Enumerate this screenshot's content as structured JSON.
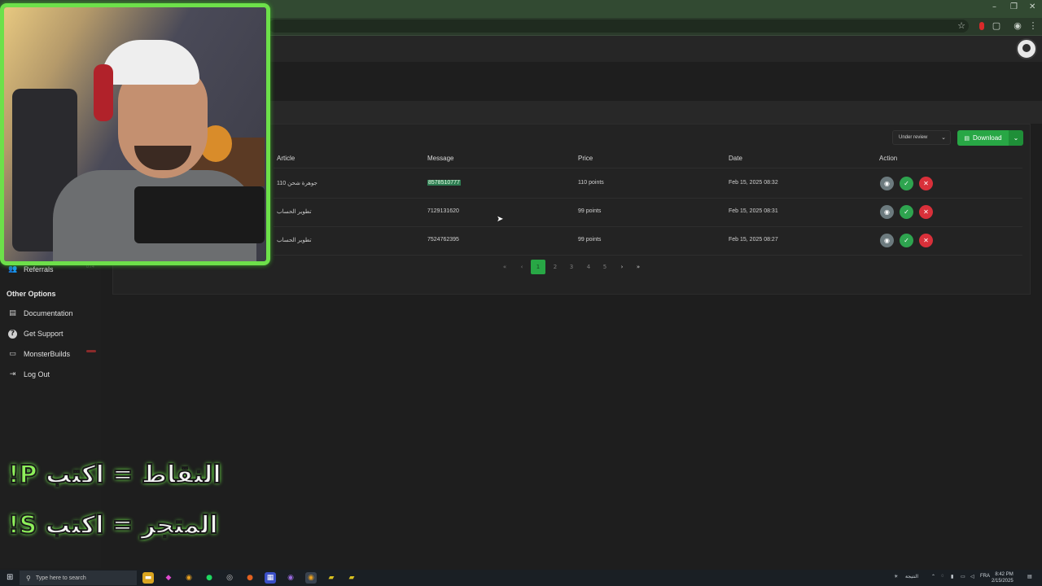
{
  "browser": {
    "window_controls": [
      "–",
      "❐",
      "✕"
    ],
    "toolbar_icons": [
      "star-icon",
      "record-icon",
      "extensions-icon",
      "profile-icon",
      "menu-icon"
    ]
  },
  "sidebar": {
    "items": [
      {
        "label": "Referrals",
        "icon": "users-icon"
      }
    ],
    "badge": "0.74",
    "other_heading": "Other Options",
    "other_items": [
      {
        "label": "Documentation",
        "icon": "book-icon"
      },
      {
        "label": "Get Support",
        "icon": "question-icon"
      },
      {
        "label": "MonsterBuilds",
        "icon": "laptop-icon"
      },
      {
        "label": "Log Out",
        "icon": "logout-icon"
      }
    ]
  },
  "toolbar": {
    "status_filter": "Under review",
    "download_label": "Download"
  },
  "table": {
    "columns": [
      "Article",
      "Message",
      "Price",
      "Date",
      "Action"
    ],
    "rows": [
      {
        "article": "جوهرة شحن 110",
        "message": "8578510777",
        "price": "110 points",
        "date": "Feb 15, 2025 08:32",
        "highlighted": true
      },
      {
        "article": "تطوير الحساب",
        "message": "7129131620",
        "price": "99 points",
        "date": "Feb 15, 2025 08:31",
        "highlighted": false
      },
      {
        "article": "تطوير الحساب",
        "message": "7524762395",
        "price": "99 points",
        "date": "Feb 15, 2025 08:27",
        "highlighted": false
      }
    ]
  },
  "pagination": {
    "pages": [
      "1",
      "2",
      "3",
      "4",
      "5"
    ],
    "current": "1",
    "first": "«",
    "prev": "‹",
    "next": "›",
    "last": "»"
  },
  "overlay": {
    "line1_text": "النقاط = اكتب",
    "line1_key": "!P",
    "line2_text": "المتجر = اكتب",
    "line2_key": "!S"
  },
  "taskbar": {
    "search_placeholder": "Type here to search",
    "weather": "النتيجة",
    "lang": "FRA",
    "time": "8:42 PM",
    "date": "2/15/2025"
  }
}
